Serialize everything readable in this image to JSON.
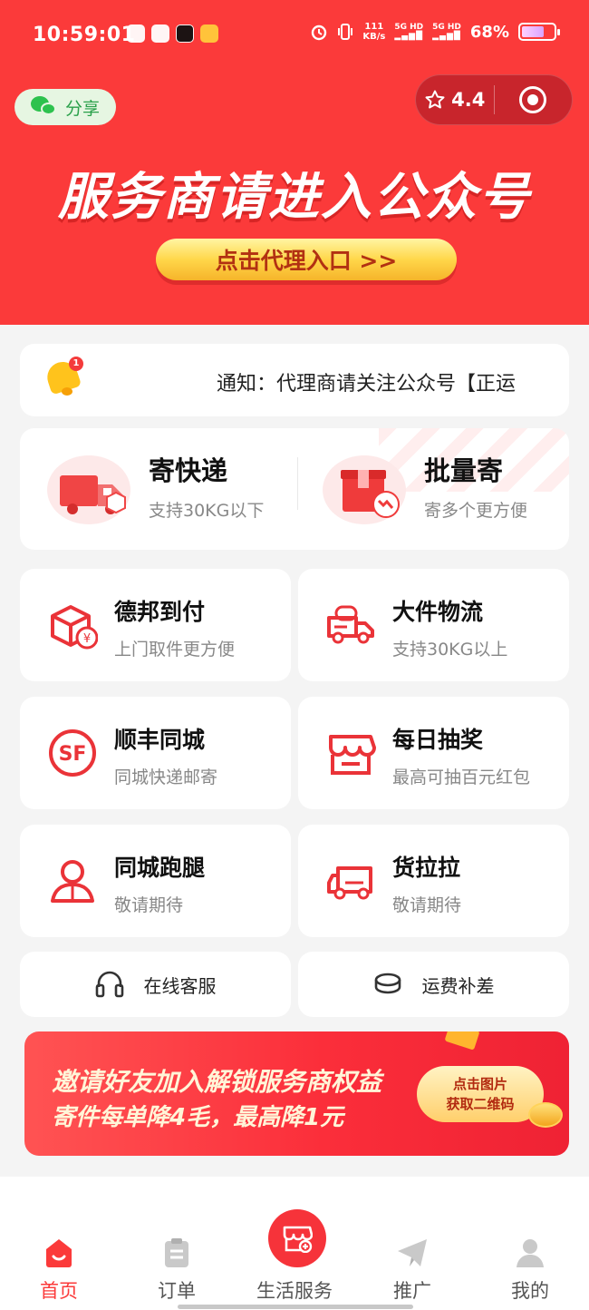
{
  "colors": {
    "primary": "#fb3a3a",
    "accent_gold": "#ffd74a",
    "icon_red": "#ea3338"
  },
  "status_bar": {
    "time": "10:59:01",
    "network_speed": "111",
    "network_unit": "KB/s",
    "signal_1": "5G HD",
    "signal_2": "5G HD",
    "battery_percent": "68%",
    "battery_level": 0.68
  },
  "header": {
    "share_label": "分享",
    "rating": "4.4",
    "banner_title": "服务商请进入公众号",
    "agent_button_label": "点击代理入口 >>"
  },
  "notice": {
    "badge_count": "1",
    "text": "通知：代理商请关注公众号【正运"
  },
  "send_options": [
    {
      "title": "寄快递",
      "subtitle": "支持30KG以下",
      "icon": "truck-icon"
    },
    {
      "title": "批量寄",
      "subtitle": "寄多个更方便",
      "icon": "boxes-icon"
    }
  ],
  "services": [
    {
      "title": "德邦到付",
      "subtitle": "上门取件更方便",
      "icon": "package-yen-icon"
    },
    {
      "title": "大件物流",
      "subtitle": "支持30KG以上",
      "icon": "freight-truck-icon"
    },
    {
      "title": "顺丰同城",
      "subtitle": "同城快递邮寄",
      "icon": "sf-logo-icon"
    },
    {
      "title": "每日抽奖",
      "subtitle": "最高可抽百元红包",
      "icon": "store-icon"
    },
    {
      "title": "同城跑腿",
      "subtitle": "敬请期待",
      "icon": "courier-person-icon"
    },
    {
      "title": "货拉拉",
      "subtitle": "敬请期待",
      "icon": "van-icon"
    }
  ],
  "quick_links": [
    {
      "label": "在线客服",
      "icon": "headset-icon"
    },
    {
      "label": "运费补差",
      "icon": "coins-icon"
    }
  ],
  "invite_banner": {
    "line1": "邀请好友加入解锁服务商权益",
    "line2": "寄件每单降4毛，最高降1元",
    "button_line1": "点击图片",
    "button_line2": "获取二维码"
  },
  "bottom_nav": [
    {
      "label": "首页",
      "icon": "home-icon",
      "active": true
    },
    {
      "label": "订单",
      "icon": "clipboard-icon",
      "active": false
    },
    {
      "label": "生活服务",
      "icon": "shop-plus-icon",
      "active": false
    },
    {
      "label": "推广",
      "icon": "paper-plane-icon",
      "active": false
    },
    {
      "label": "我的",
      "icon": "user-icon",
      "active": false
    }
  ]
}
